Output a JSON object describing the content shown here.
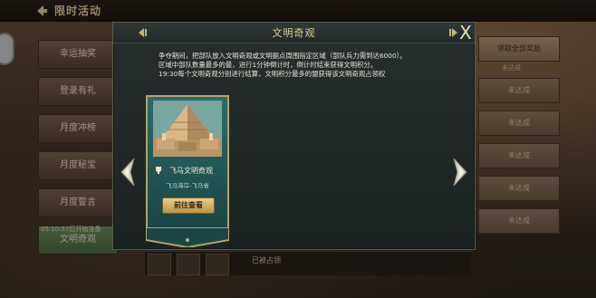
{
  "top": {
    "title": "限时活动"
  },
  "sidebar": {
    "items": [
      {
        "label": "幸运抽奖"
      },
      {
        "label": "登录有礼"
      },
      {
        "label": "月度冲榜"
      },
      {
        "label": "月度秘宝"
      },
      {
        "label": "月度誓言"
      },
      {
        "label": "文明奇观",
        "note": "05:10:57后开始准备"
      }
    ]
  },
  "right": {
    "boxes": [
      "领取全部奖励",
      "未达成",
      "未达成",
      "未达成",
      "未达成",
      "未达成"
    ],
    "label": "未达成"
  },
  "bottom": {
    "text": "已被占领"
  },
  "modal": {
    "title": "文明奇观",
    "close_label": "X",
    "description": [
      "争夺期间，把部队放入文明奇观或文明据点周围指定区域（部队兵力需到达6000）。",
      "区域中部队数量最多的最，进行1分钟倒计时，倒计时结束获得文明积分。",
      "19:30每个文明奇观分别进行结算，文明积分最多的盟获得该文明奇观占领权"
    ],
    "card": {
      "name": "飞马文明奇观",
      "location": "飞马海岸-飞马省",
      "button": "前往查看"
    }
  },
  "colors": {
    "panel": "#1f2727",
    "title_gold": "#e2cf9c",
    "banner_teal": "#2b6c6a",
    "button_gold": "#e9d08a"
  },
  "icons": [
    "back-icon",
    "close-icon",
    "trophy-icon",
    "arrow-left-icon",
    "arrow-right-icon",
    "pyramid-illustration"
  ]
}
